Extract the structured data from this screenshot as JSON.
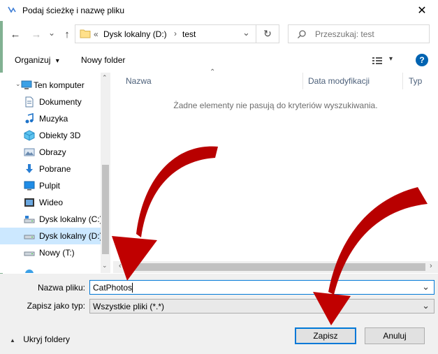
{
  "window": {
    "title": "Podaj ścieżkę i nazwę pliku",
    "close_glyph": "✕"
  },
  "nav": {
    "back_glyph": "←",
    "forward_glyph": "→",
    "dropdown_glyph": "⌄",
    "up_glyph": "↑"
  },
  "address": {
    "prefix": "«",
    "crumb1": "Dysk lokalny (D:)",
    "sep": "›",
    "crumb2": "test",
    "chevron": "⌄",
    "refresh_glyph": "↻"
  },
  "search": {
    "placeholder": "Przeszukaj: test"
  },
  "toolbar": {
    "organize_label": "Organizuj",
    "organize_caret": "▾",
    "new_folder_label": "Nowy folder",
    "view_caret": "▾",
    "help_glyph": "?"
  },
  "sidebar": {
    "items": [
      {
        "label": "Ten komputer",
        "icon": "computer-icon"
      },
      {
        "label": "Dokumenty",
        "icon": "documents-icon"
      },
      {
        "label": "Muzyka",
        "icon": "music-icon"
      },
      {
        "label": "Obiekty 3D",
        "icon": "3d-objects-icon"
      },
      {
        "label": "Obrazy",
        "icon": "pictures-icon"
      },
      {
        "label": "Pobrane",
        "icon": "downloads-icon"
      },
      {
        "label": "Pulpit",
        "icon": "desktop-icon"
      },
      {
        "label": "Wideo",
        "icon": "video-icon"
      },
      {
        "label": "Dysk lokalny (C:)",
        "icon": "drive-c-icon"
      },
      {
        "label": "Dysk lokalny (D:)",
        "icon": "drive-d-icon",
        "selected": true
      },
      {
        "label": "Nowy (T:)",
        "icon": "drive-t-icon"
      }
    ]
  },
  "columns": {
    "name": "Nazwa",
    "modified": "Data modyfikacji",
    "type": "Typ"
  },
  "file_list": {
    "empty_message": "Żadne elementy nie pasują do kryteriów wyszukiwania."
  },
  "form": {
    "filename_label": "Nazwa pliku:",
    "filename_value": "CatPhotos",
    "filetype_label": "Zapisz jako typ:",
    "filetype_value": "Wszystkie pliki (*.*)",
    "chevron": "⌄"
  },
  "footer": {
    "hide_folders_label": "Ukryj foldery",
    "hide_folders_glyph": "▲",
    "save_label": "Zapisz",
    "cancel_label": "Anuluj"
  },
  "colors": {
    "accent": "#0078d7",
    "selected_bg": "#cce8ff",
    "annotation_arrow": "#c00000"
  }
}
